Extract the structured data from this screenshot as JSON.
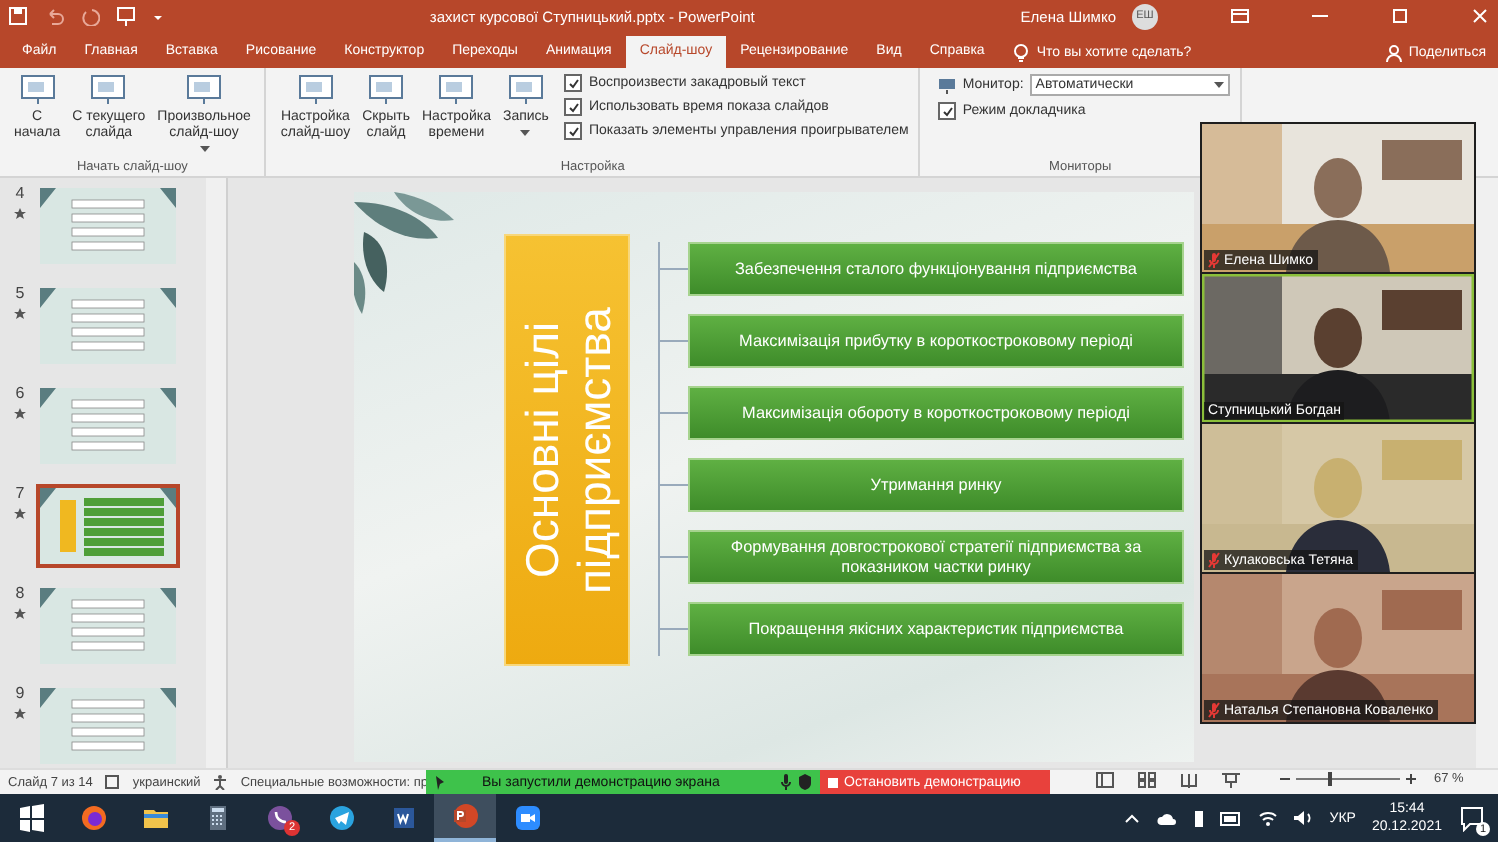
{
  "window": {
    "title": "захист курсової Ступницький.pptx  -  PowerPoint",
    "user": "Елена Шимко",
    "avatar": "ЕШ"
  },
  "menu_tabs": [
    {
      "label": "Файл",
      "selected": false
    },
    {
      "label": "Главная",
      "selected": false
    },
    {
      "label": "Вставка",
      "selected": false
    },
    {
      "label": "Рисование",
      "selected": false
    },
    {
      "label": "Конструктор",
      "selected": false
    },
    {
      "label": "Переходы",
      "selected": false
    },
    {
      "label": "Анимация",
      "selected": false
    },
    {
      "label": "Слайд-шоу",
      "selected": true
    },
    {
      "label": "Рецензирование",
      "selected": false
    },
    {
      "label": "Вид",
      "selected": false
    },
    {
      "label": "Справка",
      "selected": false
    }
  ],
  "tell_me": "Что вы хотите сделать?",
  "share": "Поделиться",
  "ribbon_groups": [
    {
      "label": "Начать слайд-шоу",
      "items": [
        {
          "kind": "big",
          "label": "С\nначала",
          "dropdown": false
        },
        {
          "kind": "big",
          "label": "С текущего\nслайда",
          "dropdown": false
        },
        {
          "kind": "big",
          "label": "Произвольное\nслайд-шоу",
          "dropdown": true
        }
      ]
    },
    {
      "label": "Настройка",
      "items": [
        {
          "kind": "big",
          "label": "Настройка\nслайд-шоу",
          "dropdown": false
        },
        {
          "kind": "big",
          "label": "Скрыть\nслайд",
          "dropdown": false
        },
        {
          "kind": "big",
          "label": "Настройка\nвремени",
          "dropdown": false
        },
        {
          "kind": "big",
          "label": "Запись",
          "dropdown": true
        },
        {
          "kind": "check",
          "label": "Воспроизвести закадровый текст",
          "checked": true
        },
        {
          "kind": "check",
          "label": "Использовать время показа слайдов",
          "checked": true
        },
        {
          "kind": "check",
          "label": "Показать элементы управления проигрывателем",
          "checked": true
        }
      ]
    },
    {
      "label": "Мониторы",
      "items": [
        {
          "kind": "select",
          "label": "Монитор:",
          "value": "Автоматически"
        },
        {
          "kind": "check",
          "label": "Режим докладчика",
          "checked": true
        }
      ]
    }
  ],
  "thumbnails": [
    {
      "number": "4",
      "selected": false
    },
    {
      "number": "5",
      "selected": false
    },
    {
      "number": "6",
      "selected": false
    },
    {
      "number": "7",
      "selected": true
    },
    {
      "number": "8",
      "selected": false
    },
    {
      "number": "9",
      "selected": false
    }
  ],
  "slide": {
    "title": "Основні цілі підприємства",
    "goals": [
      "Забезпечення сталого функціонування підприємства",
      "Максимізація прибутку в короткостроковому періоді",
      "Максимізація обороту в короткостроковому періоді",
      "Утримання ринку",
      "Формування довгострокової стратегії підприємства за показником частки ринку",
      "Покращення якісних характеристик підприємства"
    ]
  },
  "video_tiles": [
    {
      "name": "Елена Шимко",
      "muted": true,
      "selected": false
    },
    {
      "name": "Ступницький Богдан",
      "muted": false,
      "selected": true
    },
    {
      "name": "Кулаковська Тетяна",
      "muted": true,
      "selected": false
    },
    {
      "name": "Наталья Степановна Коваленко",
      "muted": true,
      "selected": false
    }
  ],
  "status_bar": {
    "slide_info": "Слайд 7 из 14",
    "language": "украинский",
    "accessibility": "Специальные возможности: пр",
    "zoom": {
      "level": 0.3,
      "reading": "67 %"
    }
  },
  "share_bar": {
    "message": "Вы запустили демонстрацию экрана",
    "stop": "Остановить демонстрацию"
  },
  "taskbar": {
    "apps": [
      {
        "kind": "windows",
        "active": false
      },
      {
        "kind": "firefox",
        "active": false
      },
      {
        "kind": "explorer",
        "active": false
      },
      {
        "kind": "calculator",
        "active": false
      },
      {
        "kind": "viber",
        "active": false,
        "badge": "2"
      },
      {
        "kind": "telegram",
        "active": false
      },
      {
        "kind": "word",
        "active": false
      },
      {
        "kind": "powerpoint",
        "active": true
      },
      {
        "kind": "zoom",
        "active": false
      }
    ],
    "language": "УКР",
    "time": "15:44",
    "date": "20.12.2021",
    "notifications": "1"
  }
}
